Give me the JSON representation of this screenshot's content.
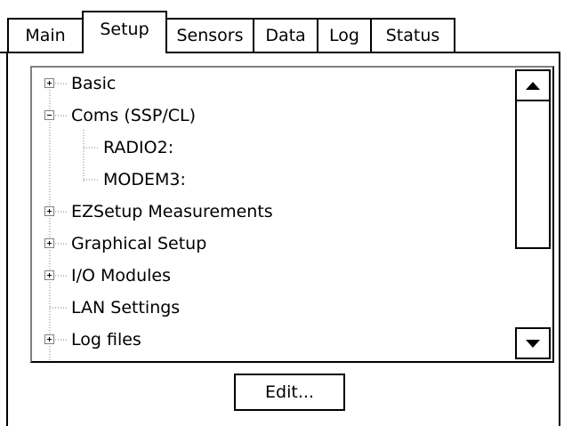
{
  "tabs": [
    {
      "label": "Main"
    },
    {
      "label": "Setup"
    },
    {
      "label": "Sensors"
    },
    {
      "label": "Data"
    },
    {
      "label": "Log"
    },
    {
      "label": "Status"
    }
  ],
  "active_tab": "Setup",
  "tree": {
    "items": [
      {
        "label": "Basic",
        "expander": "plus"
      },
      {
        "label": "Coms (SSP/CL)",
        "expander": "minus"
      },
      {
        "label": "RADIO2:",
        "expander": "none"
      },
      {
        "label": "MODEM3:",
        "expander": "none"
      },
      {
        "label": "EZSetup Measurements",
        "expander": "plus"
      },
      {
        "label": "Graphical Setup",
        "expander": "plus"
      },
      {
        "label": "I/O Modules",
        "expander": "plus"
      },
      {
        "label": "LAN Settings",
        "expander": "none"
      },
      {
        "label": "Log files",
        "expander": "plus"
      }
    ]
  },
  "scrollbar": {
    "up_icon": "triangle-up-icon",
    "down_icon": "triangle-down-icon",
    "position": 0.0
  },
  "edit_button": {
    "label": "Edit..."
  }
}
